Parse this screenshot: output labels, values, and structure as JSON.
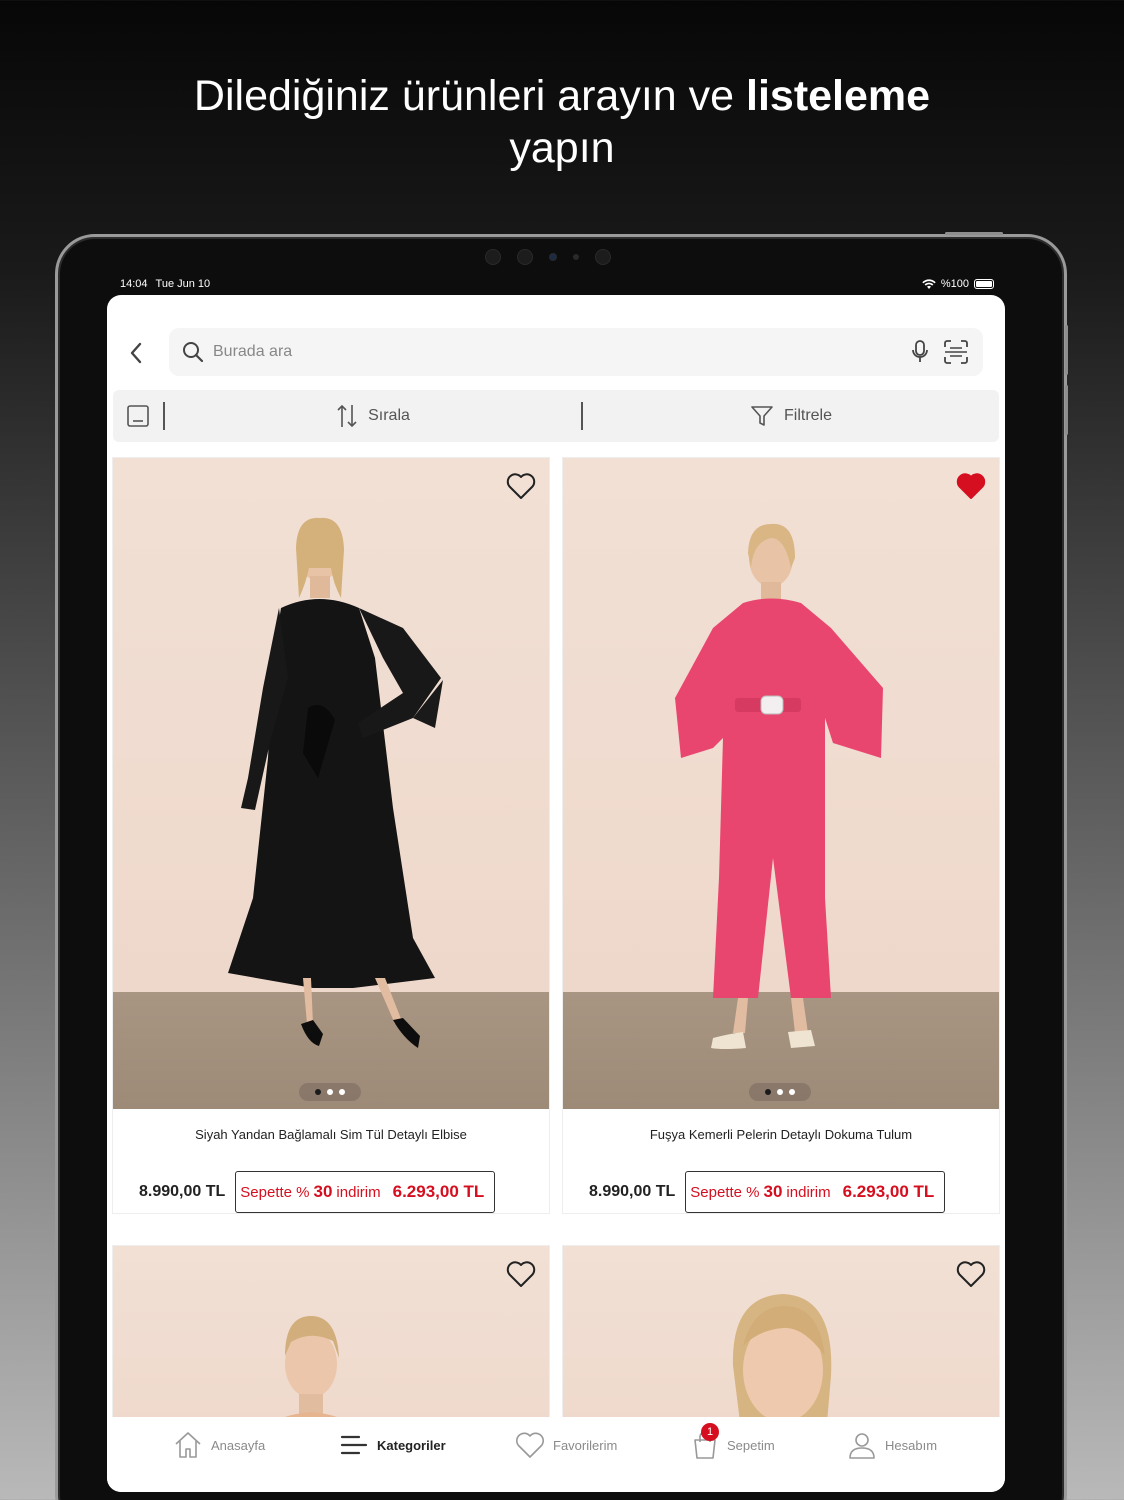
{
  "headline": {
    "text_regular": "Dilediğiniz ürünleri arayın ve ",
    "text_bold": "listeleme",
    "text_tail": "yapın"
  },
  "status": {
    "time": "14:04",
    "date": "Tue Jun 10",
    "battery": "%100"
  },
  "search": {
    "placeholder": "Burada ara"
  },
  "toolbar": {
    "sort_label": "Sırala",
    "filter_label": "Filtrele"
  },
  "products": [
    {
      "name": "Siyah Yandan Bağlamalı Sim Tül Detaylı Elbise",
      "price": "8.990,00 TL",
      "promo_prefix": "Sepette %",
      "promo_pct": "30",
      "promo_suffix": " indirim",
      "promo_price": "6.293,00 TL",
      "favorited": false,
      "garment_color": "#151515"
    },
    {
      "name": "Fuşya Kemerli Pelerin Detaylı Dokuma Tulum",
      "price": "8.990,00 TL",
      "promo_prefix": "Sepette %",
      "promo_pct": "30",
      "promo_suffix": " indirim",
      "promo_price": "6.293,00 TL",
      "favorited": true,
      "garment_color": "#e9466f"
    },
    {
      "favorited": false
    },
    {
      "favorited": false
    }
  ],
  "tabs": [
    {
      "label": "Anasayfa",
      "icon": "home-icon"
    },
    {
      "label": "Kategoriler",
      "icon": "menu-icon",
      "active": true
    },
    {
      "label": "Favorilerim",
      "icon": "heart-icon"
    },
    {
      "label": "Sepetim",
      "icon": "cart-icon",
      "badge": "1"
    },
    {
      "label": "Hesabım",
      "icon": "user-icon"
    }
  ],
  "colors": {
    "accent": "#d50f1f",
    "badge": "#d50f1f",
    "text": "#222222"
  }
}
